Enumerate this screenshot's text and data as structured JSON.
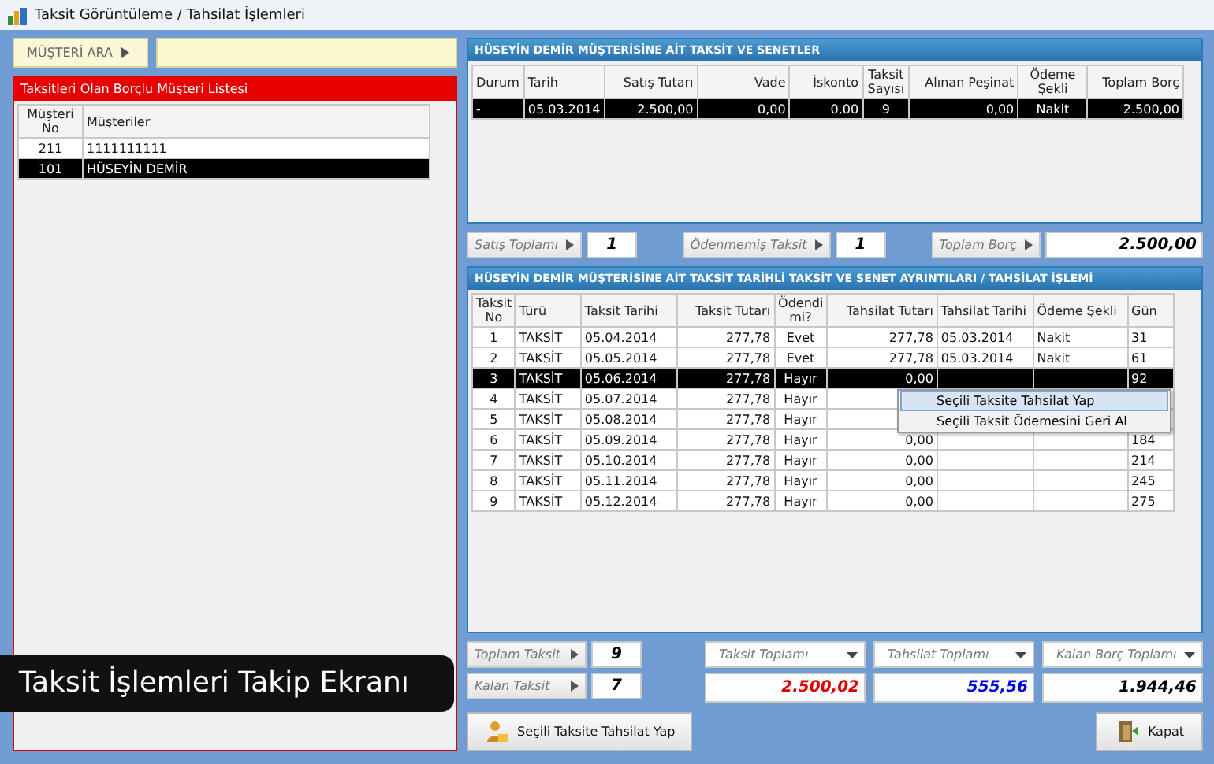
{
  "window": {
    "title": "Taksit Görüntüleme / Tahsilat İşlemleri"
  },
  "search": {
    "label": "MÜŞTERİ ARA"
  },
  "customer_list": {
    "title": "Taksitleri Olan Borçlu Müşteri Listesi",
    "columns": [
      "Müşteri No",
      "Müşteriler"
    ],
    "rows": [
      {
        "cells": [
          "211",
          "1111111111"
        ],
        "selected": false
      },
      {
        "cells": [
          "101",
          "HÜSEYİN DEMİR"
        ],
        "selected": true
      }
    ]
  },
  "sales_panel": {
    "title": "HÜSEYİN DEMİR MÜŞTERİSİNE AİT TAKSİT VE SENETLER",
    "columns": [
      "Durum",
      "Tarih",
      "Satış Tutarı",
      "Vade",
      "İskonto",
      "Taksit Sayısı",
      "Alınan Peşinat",
      "Ödeme Şekli",
      "Toplam Borç"
    ],
    "rows": [
      {
        "cells": [
          "-",
          "05.03.2014",
          "2.500,00",
          "0,00",
          "0,00",
          "9",
          "0,00",
          "Nakit",
          "2.500,00"
        ],
        "selected": true
      }
    ]
  },
  "sales_summary": [
    {
      "label": "Satış Toplamı",
      "value": "1",
      "kind": "small"
    },
    {
      "label": "Ödenmemiş Taksit",
      "value": "1",
      "kind": "small"
    },
    {
      "label": "Toplam Borç",
      "value": "2.500,00",
      "kind": "wide"
    }
  ],
  "installments_panel": {
    "title": "HÜSEYİN DEMİR MÜŞTERİSİNE AİT TAKSİT TARİHLİ TAKSİT VE SENET AYRINTILARI / TAHSİLAT İŞLEMİ",
    "columns": [
      "Taksit No",
      "Türü",
      "Taksit Tarihi",
      "Taksit Tutarı",
      "Ödendi mi?",
      "Tahsilat Tutarı",
      "Tahsilat Tarihi",
      "Ödeme Şekli",
      "Gün"
    ],
    "rows": [
      {
        "cells": [
          "1",
          "TAKSİT",
          "05.04.2014",
          "277,78",
          "Evet",
          "277,78",
          "05.03.2014",
          "Nakit",
          "31"
        ],
        "selected": false
      },
      {
        "cells": [
          "2",
          "TAKSİT",
          "05.05.2014",
          "277,78",
          "Evet",
          "277,78",
          "05.03.2014",
          "Nakit",
          "61"
        ],
        "selected": false
      },
      {
        "cells": [
          "3",
          "TAKSİT",
          "05.06.2014",
          "277,78",
          "Hayır",
          "0,00",
          null,
          null,
          "92"
        ],
        "selected": true
      },
      {
        "cells": [
          "4",
          "TAKSİT",
          "05.07.2014",
          "277,78",
          "Hayır"
        ],
        "selected": false
      },
      {
        "cells": [
          "5",
          "TAKSİT",
          "05.08.2014",
          "277,78",
          "Hayır"
        ],
        "selected": false
      },
      {
        "cells": [
          "6",
          "TAKSİT",
          "05.09.2014",
          "277,78",
          "Hayır",
          "0,00",
          null,
          null,
          "184"
        ],
        "selected": false
      },
      {
        "cells": [
          "7",
          "TAKSİT",
          "05.10.2014",
          "277,78",
          "Hayır",
          "0,00",
          null,
          null,
          "214"
        ],
        "selected": false
      },
      {
        "cells": [
          "8",
          "TAKSİT",
          "05.11.2014",
          "277,78",
          "Hayır",
          "0,00",
          null,
          null,
          "245"
        ],
        "selected": false
      },
      {
        "cells": [
          "9",
          "TAKSİT",
          "05.12.2014",
          "277,78",
          "Hayır",
          "0,00",
          null,
          null,
          "275"
        ],
        "selected": false
      }
    ]
  },
  "context_menu": {
    "items": [
      {
        "label": "Seçili Taksite Tahsilat Yap",
        "selected": true
      },
      {
        "label": "Seçili Taksit Ödemesini Geri Al",
        "selected": false
      }
    ]
  },
  "installment_counts": [
    {
      "label": "Toplam Taksit",
      "value": "9"
    },
    {
      "label": "Kalan Taksit",
      "value": "7"
    }
  ],
  "totals": [
    {
      "label": "Taksit Toplamı",
      "value": "2.500,02",
      "color": "#e00000"
    },
    {
      "label": "Tahsilat Toplamı",
      "value": "555,56",
      "color": "#0000e0"
    },
    {
      "label": "Kalan Borç Toplamı",
      "value": "1.944,46",
      "color": "#000000"
    }
  ],
  "buttons": [
    {
      "label": "Seçili Taksite Tahsilat Yap",
      "kind": "collect"
    },
    {
      "label": "Kapat",
      "kind": "close"
    }
  ],
  "caption": "Taksit İşlemleri Takip Ekranı"
}
